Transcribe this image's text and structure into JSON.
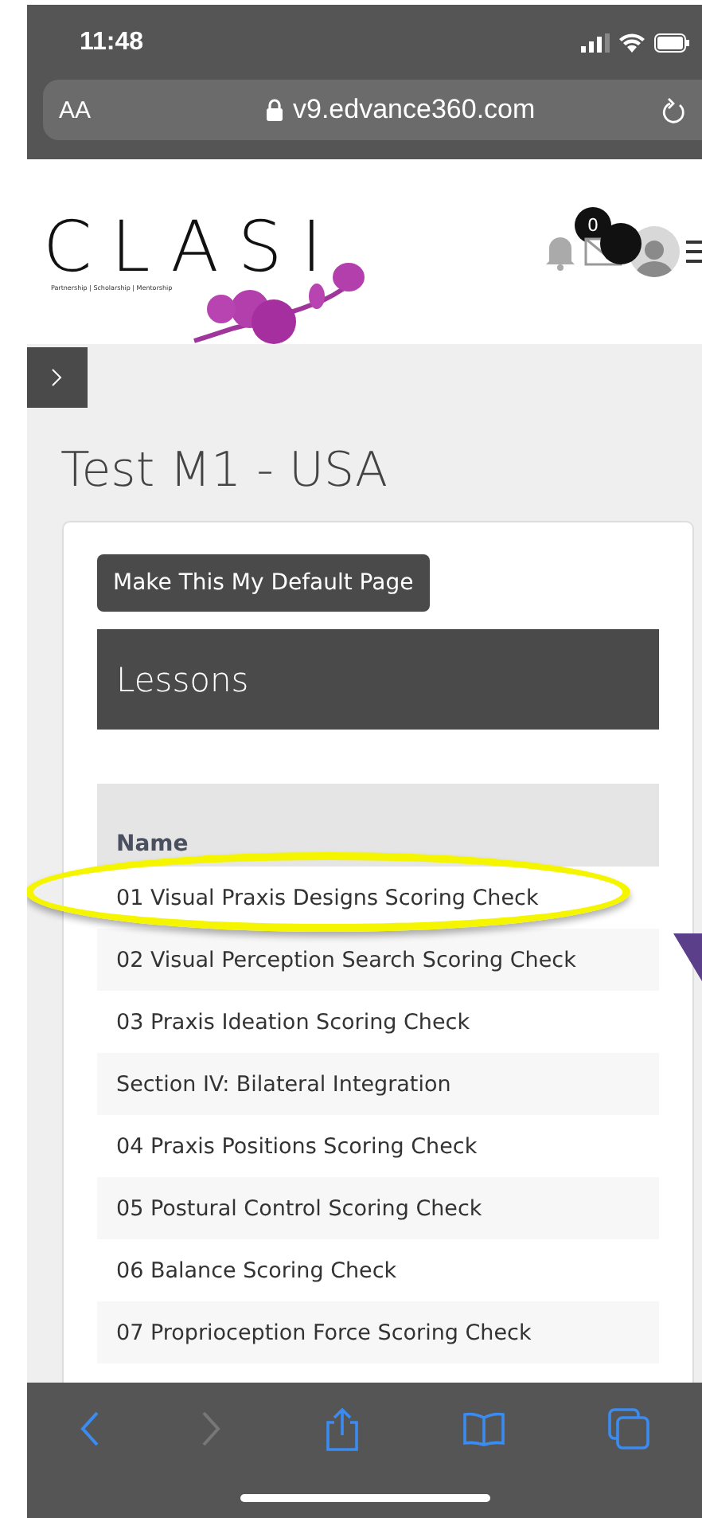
{
  "status_bar": {
    "time": "11:48"
  },
  "address_bar": {
    "text_size": "AA",
    "url": "v9.edvance360.com"
  },
  "header": {
    "logo": {
      "name": "CLASI",
      "tagline": "Partnership | Scholarship | Mentorship"
    },
    "notifications": {
      "count": "0"
    }
  },
  "page": {
    "title": "Test M1 - USA",
    "default_button": "Make This My Default Page",
    "panel_title": "Lessons",
    "table": {
      "columns": [
        "Name"
      ],
      "rows": [
        {
          "name": "01 Visual Praxis Designs Scoring Check",
          "highlighted": true
        },
        {
          "name": "02 Visual Perception Search Scoring Check",
          "highlighted": false
        },
        {
          "name": "03 Praxis Ideation Scoring Check",
          "highlighted": false
        },
        {
          "name": "Section IV: Bilateral Integration",
          "highlighted": false
        },
        {
          "name": "04 Praxis Positions Scoring Check",
          "highlighted": false
        },
        {
          "name": "05 Postural Control Scoring Check",
          "highlighted": false
        },
        {
          "name": "06 Balance Scoring Check",
          "highlighted": false
        },
        {
          "name": "07 Proprioception Force Scoring Check",
          "highlighted": false
        }
      ]
    }
  },
  "toolbar": {
    "back_disabled": false,
    "forward_disabled": true
  }
}
